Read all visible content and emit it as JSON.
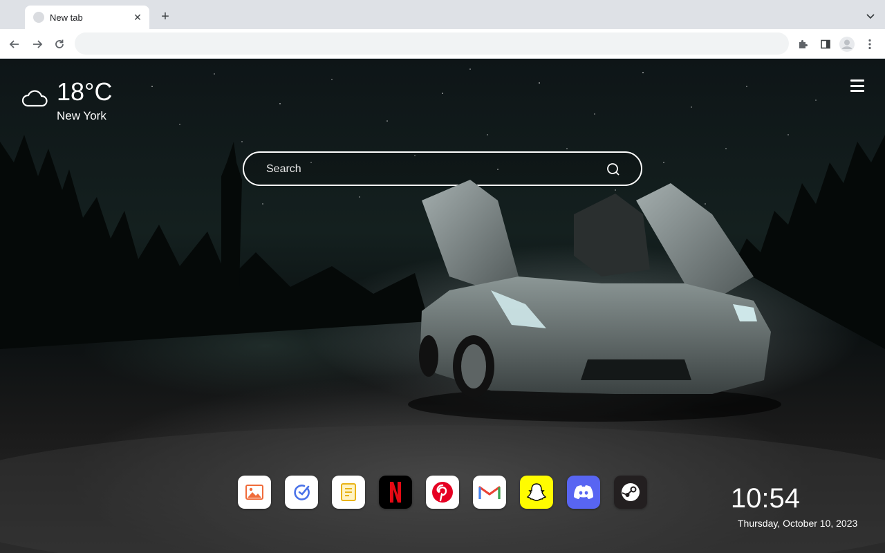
{
  "browser": {
    "tab_title": "New tab",
    "omnibox_placeholder": ""
  },
  "weather": {
    "temperature": "18°C",
    "city": "New York",
    "icon": "cloud-icon"
  },
  "search": {
    "placeholder": "Search"
  },
  "dock": {
    "apps": [
      {
        "name": "photos",
        "icon": "image-icon",
        "color": "#ffffff"
      },
      {
        "name": "tasks",
        "icon": "check-circle-icon",
        "color": "#ffffff"
      },
      {
        "name": "notes",
        "icon": "note-icon",
        "color": "#ffffff"
      },
      {
        "name": "netflix",
        "icon": "netflix-icon",
        "color": "#000000"
      },
      {
        "name": "pinterest",
        "icon": "pinterest-icon",
        "color": "#ffffff"
      },
      {
        "name": "gmail",
        "icon": "gmail-icon",
        "color": "#ffffff"
      },
      {
        "name": "snapchat",
        "icon": "snapchat-icon",
        "color": "#fffc00"
      },
      {
        "name": "discord",
        "icon": "discord-icon",
        "color": "#5865f2"
      },
      {
        "name": "steam",
        "icon": "steam-icon",
        "color": "#231f20"
      }
    ]
  },
  "clock": {
    "time": "10:54",
    "date": "Thursday, October 10, 2023"
  }
}
